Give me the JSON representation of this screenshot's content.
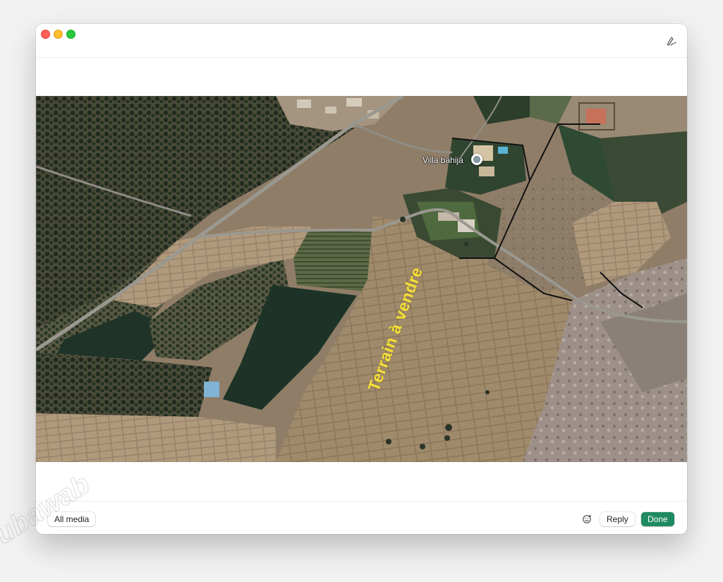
{
  "window": {
    "controls": [
      "close",
      "minimize",
      "maximize"
    ],
    "toolbar_icon": "markup-pen-icon"
  },
  "photo": {
    "place_label": "Villa bahija",
    "overlay_text": "Terrain à vendre",
    "overlay_color": "#f4df3a"
  },
  "watermark": {
    "text": "ubawab"
  },
  "footer": {
    "all_media_label": "All media",
    "emoji_icon": "smiley-face-icon",
    "reply_label": "Reply",
    "done_label": "Done",
    "done_color": "#1f8a62"
  }
}
